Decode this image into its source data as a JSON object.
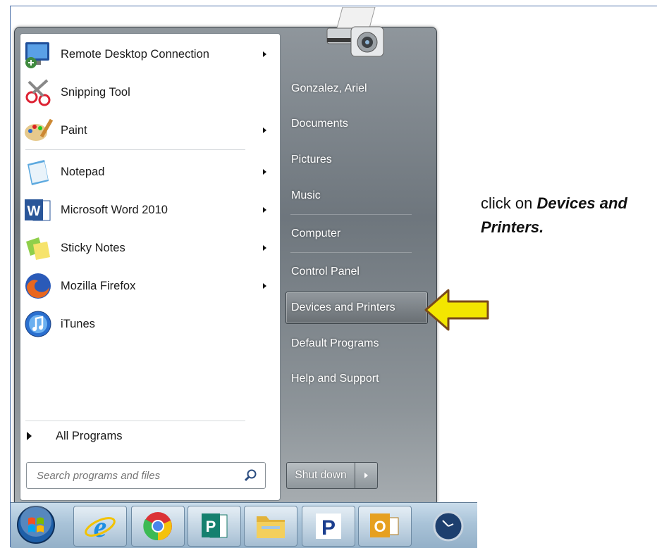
{
  "start_menu": {
    "programs": [
      {
        "label": "Remote Desktop Connection",
        "icon": "remote-desktop-icon",
        "has_submenu": true
      },
      {
        "label": "Snipping Tool",
        "icon": "snipping-tool-icon",
        "has_submenu": false
      },
      {
        "label": "Paint",
        "icon": "paint-icon",
        "has_submenu": true
      },
      {
        "label": "Notepad",
        "icon": "notepad-icon",
        "has_submenu": true
      },
      {
        "label": "Microsoft Word 2010",
        "icon": "word-icon",
        "has_submenu": true
      },
      {
        "label": "Sticky Notes",
        "icon": "sticky-notes-icon",
        "has_submenu": true
      },
      {
        "label": "Mozilla Firefox",
        "icon": "firefox-icon",
        "has_submenu": true
      },
      {
        "label": "iTunes",
        "icon": "itunes-icon",
        "has_submenu": false
      }
    ],
    "all_programs": "All Programs",
    "search": {
      "placeholder": "Search programs and files"
    },
    "right_links": [
      {
        "label": "Gonzalez, Ariel"
      },
      {
        "label": "Documents"
      },
      {
        "label": "Pictures"
      },
      {
        "label": "Music"
      },
      {
        "label": "Computer"
      },
      {
        "label": "Control Panel"
      },
      {
        "label": "Devices and Printers",
        "selected": true
      },
      {
        "label": "Default Programs"
      },
      {
        "label": "Help and Support"
      }
    ],
    "shutdown": "Shut down"
  },
  "taskbar": {
    "items": [
      "start-orb-icon",
      "internet-explorer-icon",
      "chrome-icon",
      "publisher-icon",
      "file-explorer-icon",
      "p-app-icon",
      "outlook-icon",
      "clock-app-icon"
    ]
  },
  "annotation": {
    "prefix": "click on ",
    "bold": "Devices and Printers."
  },
  "colors": {
    "accent_arrow": "#f3e600",
    "arrow_outline": "#7a4a1a"
  }
}
